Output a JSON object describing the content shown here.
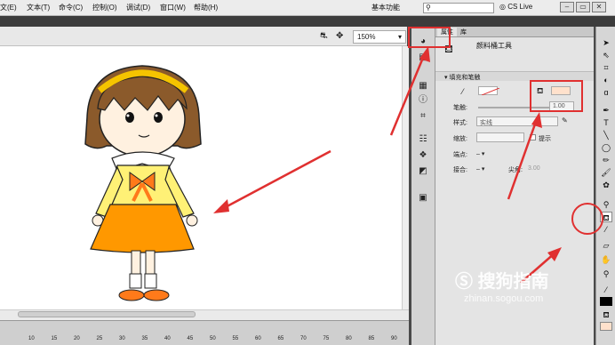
{
  "menubar": {
    "items": [
      "文(E)",
      "文本(T)",
      "命令(C)",
      "控制(O)",
      "调试(D)",
      "窗口(W)",
      "帮助(H)"
    ],
    "workspace": "基本功能",
    "cs_live": "CS Live"
  },
  "stage": {
    "zoom": "150%"
  },
  "ruler": {
    "ticks": [
      "10",
      "15",
      "20",
      "25",
      "30",
      "35",
      "40",
      "45",
      "50",
      "55",
      "60",
      "65",
      "70",
      "75",
      "80",
      "85",
      "90"
    ]
  },
  "panel": {
    "tabs": [
      "属性",
      "库"
    ],
    "tool_name": "颜料桶工具",
    "section": "填充和笔触",
    "stroke_label": "笔触:",
    "stroke_value": "1.00",
    "style_label": "样式:",
    "style_value": "实线",
    "scale_label": "缩放:",
    "hint_label": "提示",
    "cap_label": "端点:",
    "join_label": "接合:",
    "miter_label": "尖角:",
    "miter_value": "3.00",
    "fill_color": "#ffe1cc"
  },
  "watermark": {
    "brand": "搜狗指南",
    "url": "zhinan.sogou.com"
  },
  "colors": {
    "annotation": "#e03030",
    "hair": "#8b5a2b",
    "dress": "#ff9800",
    "shirt": "#fff176"
  }
}
